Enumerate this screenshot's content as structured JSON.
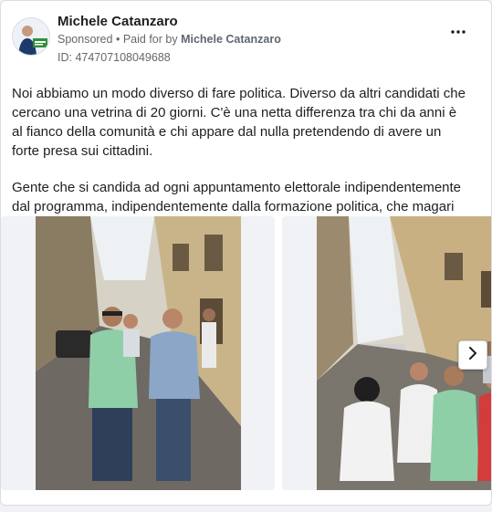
{
  "ad": {
    "page_name": "Michele Catanzaro",
    "sponsored_label": "Sponsored",
    "separator": "•",
    "paid_for_prefix": "Paid for by",
    "paid_for_name": "Michele Catanzaro",
    "ad_id": "ID: 474707108049688",
    "more_icon": "more-horizontal-icon",
    "paragraphs": [
      "Noi abbiamo un modo diverso di fare politica. Diverso da altri candidati che cercano una vetrina di 20 giorni. C'è una netta differenza tra chi da anni è al fianco della comunità e chi appare dal nulla pretendendo di avere un forte presa sui cittadini.",
      "Gente che si candida ad ogni appuntamento elettorale indipendentemente dal programma, indipendentemente dalla formazione politica, che magari aveva..."
    ]
  },
  "carousel": {
    "slides": [
      {
        "name": "street-photo-1"
      },
      {
        "name": "street-photo-2"
      }
    ],
    "next_icon": "chevron-right-icon"
  },
  "colors": {
    "card_bg": "#ffffff",
    "page_bg": "#f0f2f5",
    "secondary_text": "#65676b"
  }
}
